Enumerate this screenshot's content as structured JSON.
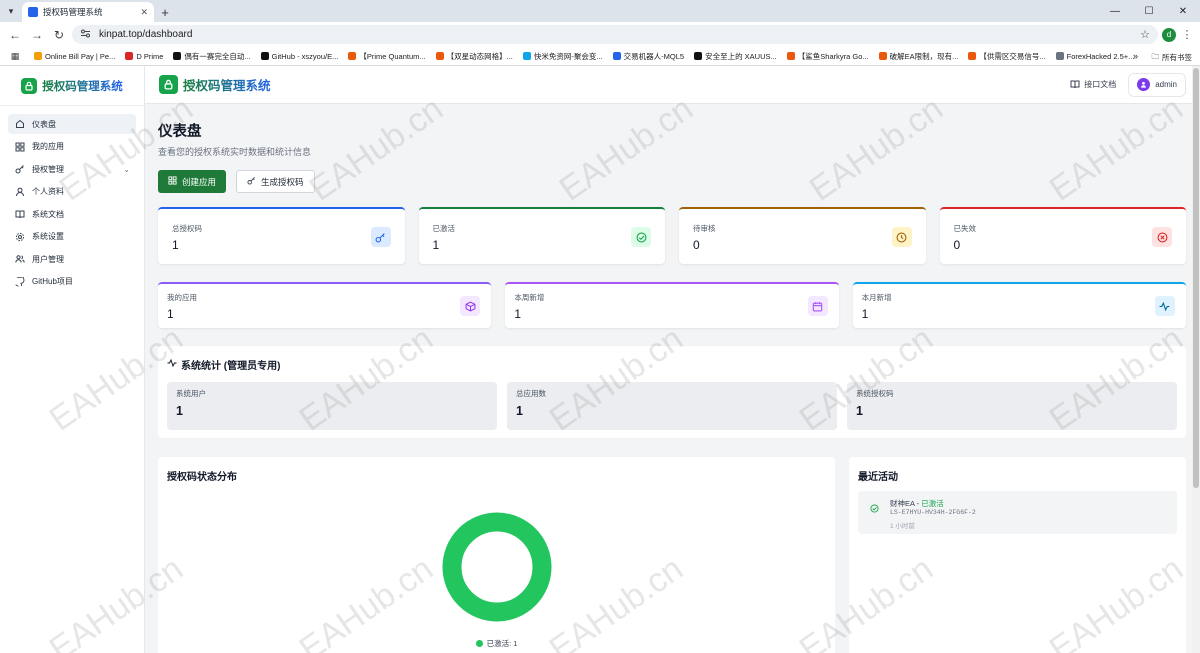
{
  "browser": {
    "tab_title": "授权码管理系统",
    "url": "kinpat.top/dashboard",
    "profile_letter": "d",
    "bookmarks": [
      "Online Bill Pay | Pe...",
      "D Prime",
      "偶有一赛完全自动...",
      "GitHub - xszyou/E...",
      "【Prime Quantum...",
      "【双星动态网格】...",
      "快米免资网-聚会变...",
      "交易机器人-MQL5",
      "安全至上的 XAUUS...",
      "【鲨鱼Sharkyra Go...",
      "破解EA限制，现有...",
      "【供需区交易信号...",
      "ForexHacked 2.5+..."
    ],
    "bookmarks_more": "»",
    "all_bookmarks": "所有书签"
  },
  "sidebar": {
    "brand": "授权码管理系统",
    "items": [
      {
        "label": "仪表盘",
        "icon": "home-icon"
      },
      {
        "label": "我的应用",
        "icon": "grid-icon"
      },
      {
        "label": "授权管理",
        "icon": "key-icon"
      },
      {
        "label": "个人资料",
        "icon": "user-icon"
      },
      {
        "label": "系统文档",
        "icon": "book-icon"
      },
      {
        "label": "系统设置",
        "icon": "gear-icon"
      },
      {
        "label": "用户管理",
        "icon": "users-icon"
      },
      {
        "label": "GitHub项目",
        "icon": "github-icon"
      }
    ]
  },
  "header": {
    "brand": "授权码管理系统",
    "api_docs": "接口文档",
    "user": "admin"
  },
  "page": {
    "title": "仪表盘",
    "subtitle": "查看您的授权系统实时数据和统计信息",
    "create_app": "创建应用",
    "generate_code": "生成授权码"
  },
  "stats": [
    {
      "label": "总授权码",
      "value": "1",
      "color": "#2563eb",
      "icon": "key-icon"
    },
    {
      "label": "已激活",
      "value": "1",
      "color": "#15803d",
      "icon": "check-circle-icon"
    },
    {
      "label": "待审核",
      "value": "0",
      "color": "#a16207",
      "icon": "clock-icon"
    },
    {
      "label": "已失效",
      "value": "0",
      "color": "#dc2626",
      "icon": "x-circle-icon"
    }
  ],
  "stats2": [
    {
      "label": "我的应用",
      "value": "1",
      "color": "#8b5cf6",
      "icon": "box-icon"
    },
    {
      "label": "本周新增",
      "value": "1",
      "color": "#a855f7",
      "icon": "calendar-icon"
    },
    {
      "label": "本月新增",
      "value": "1",
      "color": "#0ea5e9",
      "icon": "activity-icon"
    }
  ],
  "system": {
    "title": "系统统计 (管理员专用)",
    "cards": [
      {
        "label": "系统用户",
        "value": "1"
      },
      {
        "label": "总应用数",
        "value": "1"
      },
      {
        "label": "系统授权码",
        "value": "1"
      }
    ]
  },
  "status_chart": {
    "title": "授权码状态分布",
    "legend_label": "已激活: 1"
  },
  "chart_data": {
    "type": "pie",
    "categories": [
      "已激活"
    ],
    "values": [
      1
    ],
    "colors": [
      "#22c55e"
    ]
  },
  "activity": {
    "title": "最近活动",
    "items": [
      {
        "name": "财神EA",
        "sep": " - ",
        "status": "已激活",
        "code": "LS-E7HYU-HV34H-2FG6F-2",
        "time": "1 小时前"
      }
    ]
  },
  "watermark": "EAHub.cn"
}
